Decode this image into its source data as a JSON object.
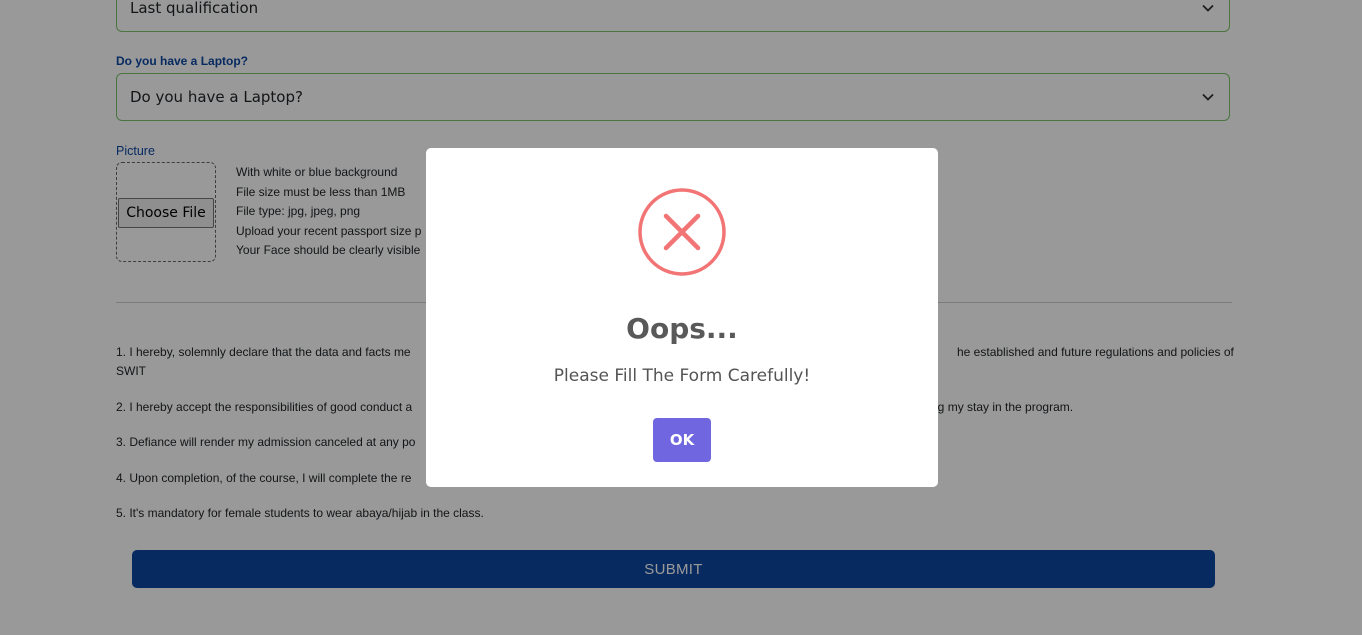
{
  "form": {
    "qualification_select": {
      "value": "Last qualification"
    },
    "laptop_label": "Do you have a Laptop?",
    "laptop_select": {
      "value": "Do you have a Laptop?"
    },
    "picture_label": "Picture",
    "file_button": "Choose File",
    "picture_notes": [
      "With white or blue background",
      "File size must be less than 1MB",
      "File type: jpg, jpeg, png",
      "Upload your recent passport size p",
      "Your Face should be clearly visible"
    ],
    "declarations": [
      {
        "left": "1. I hereby, solemnly declare that the data and facts me",
        "right": "he established and future regulations and policies of",
        "cont": "SWIT"
      },
      {
        "left": "2. I hereby accept the responsibilities of good conduct a",
        "right": "during my stay in the program."
      },
      {
        "left": "3. Defiance will render my admission canceled at any po"
      },
      {
        "left": "4. Upon completion, of the course, I will complete the re"
      },
      {
        "left": "5. It's mandatory for female students to wear abaya/hijab in the class."
      }
    ],
    "submit_label": "SUBMIT"
  },
  "modal": {
    "icon": "error-x-icon",
    "title": "Oops...",
    "text": "Please Fill The Form Carefully!",
    "ok_label": "OK",
    "colors": {
      "icon": "#f27474",
      "ok": "#7066e0"
    }
  },
  "colors": {
    "border_valid": "#7cc36a",
    "primary": "#0d47a1",
    "overlay": "rgba(0,0,0,0.4)"
  }
}
